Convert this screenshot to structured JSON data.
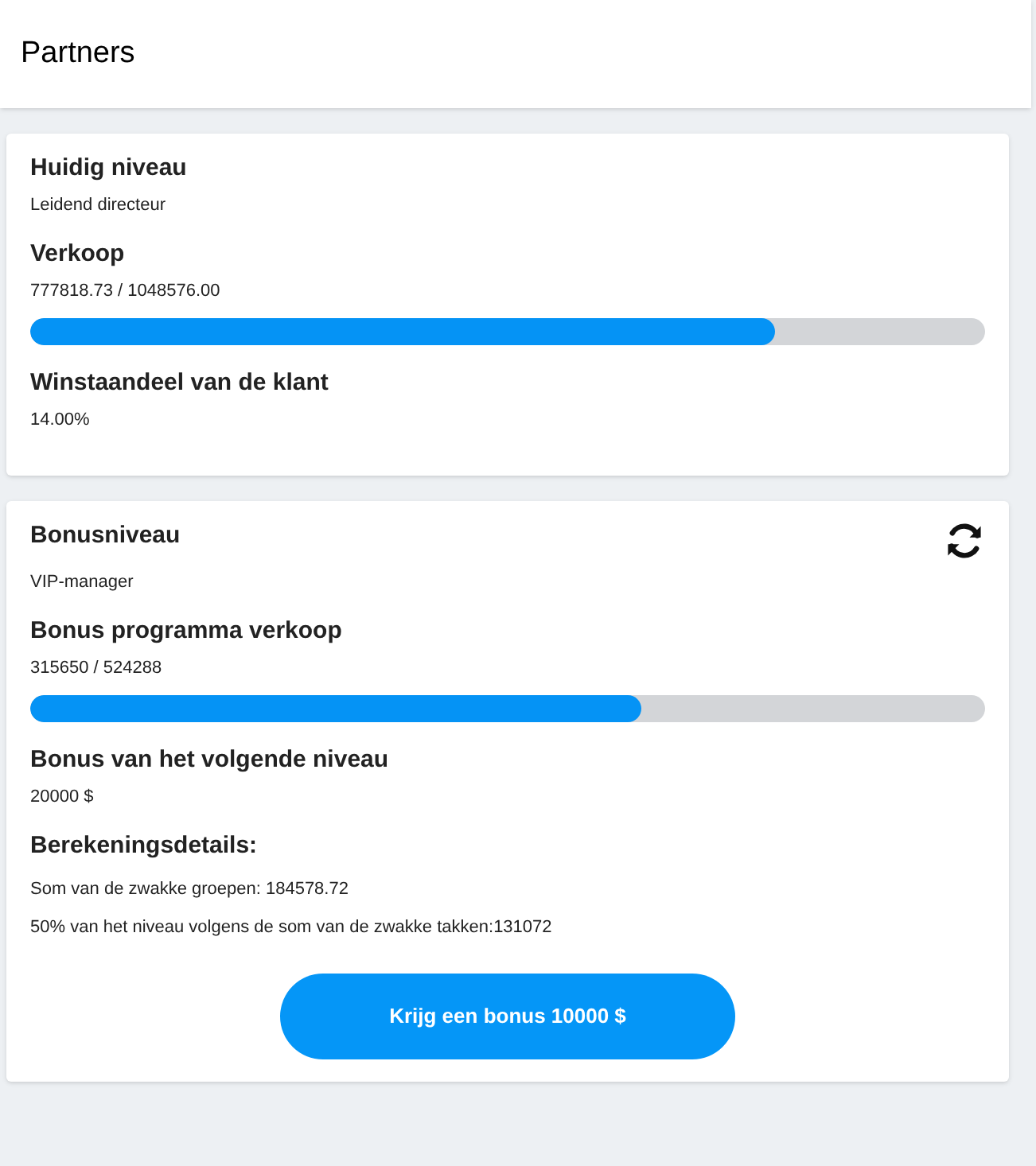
{
  "header": {
    "title": "Partners"
  },
  "cards": [
    {
      "refresh": false,
      "fields": [
        {
          "label": "Huidig niveau",
          "value": "Leidend directeur"
        },
        {
          "label": "Verkoop",
          "value": "777818.73 / 1048576.00",
          "level": 0.78
        },
        {
          "label": "Winstaandeel van de klant",
          "value": "14.00%"
        }
      ]
    },
    {
      "refresh": true,
      "fields": [
        {
          "label": "Bonusniveau",
          "value": "VIP-manager"
        },
        {
          "label": "Bonus programma verkoop",
          "value": "315650 / 524288",
          "level": 0.64
        },
        {
          "label": "Bonus van het volgende niveau",
          "value": "20000 $"
        }
      ],
      "details": {
        "label": "Berekeningsdetails:",
        "lines": [
          "Som van de zwakke groepen: 184578.72",
          "50% van het niveau volgens de som van de zwakke takken:131072"
        ]
      },
      "button": "Krijg een bonus 10000 $"
    }
  ]
}
